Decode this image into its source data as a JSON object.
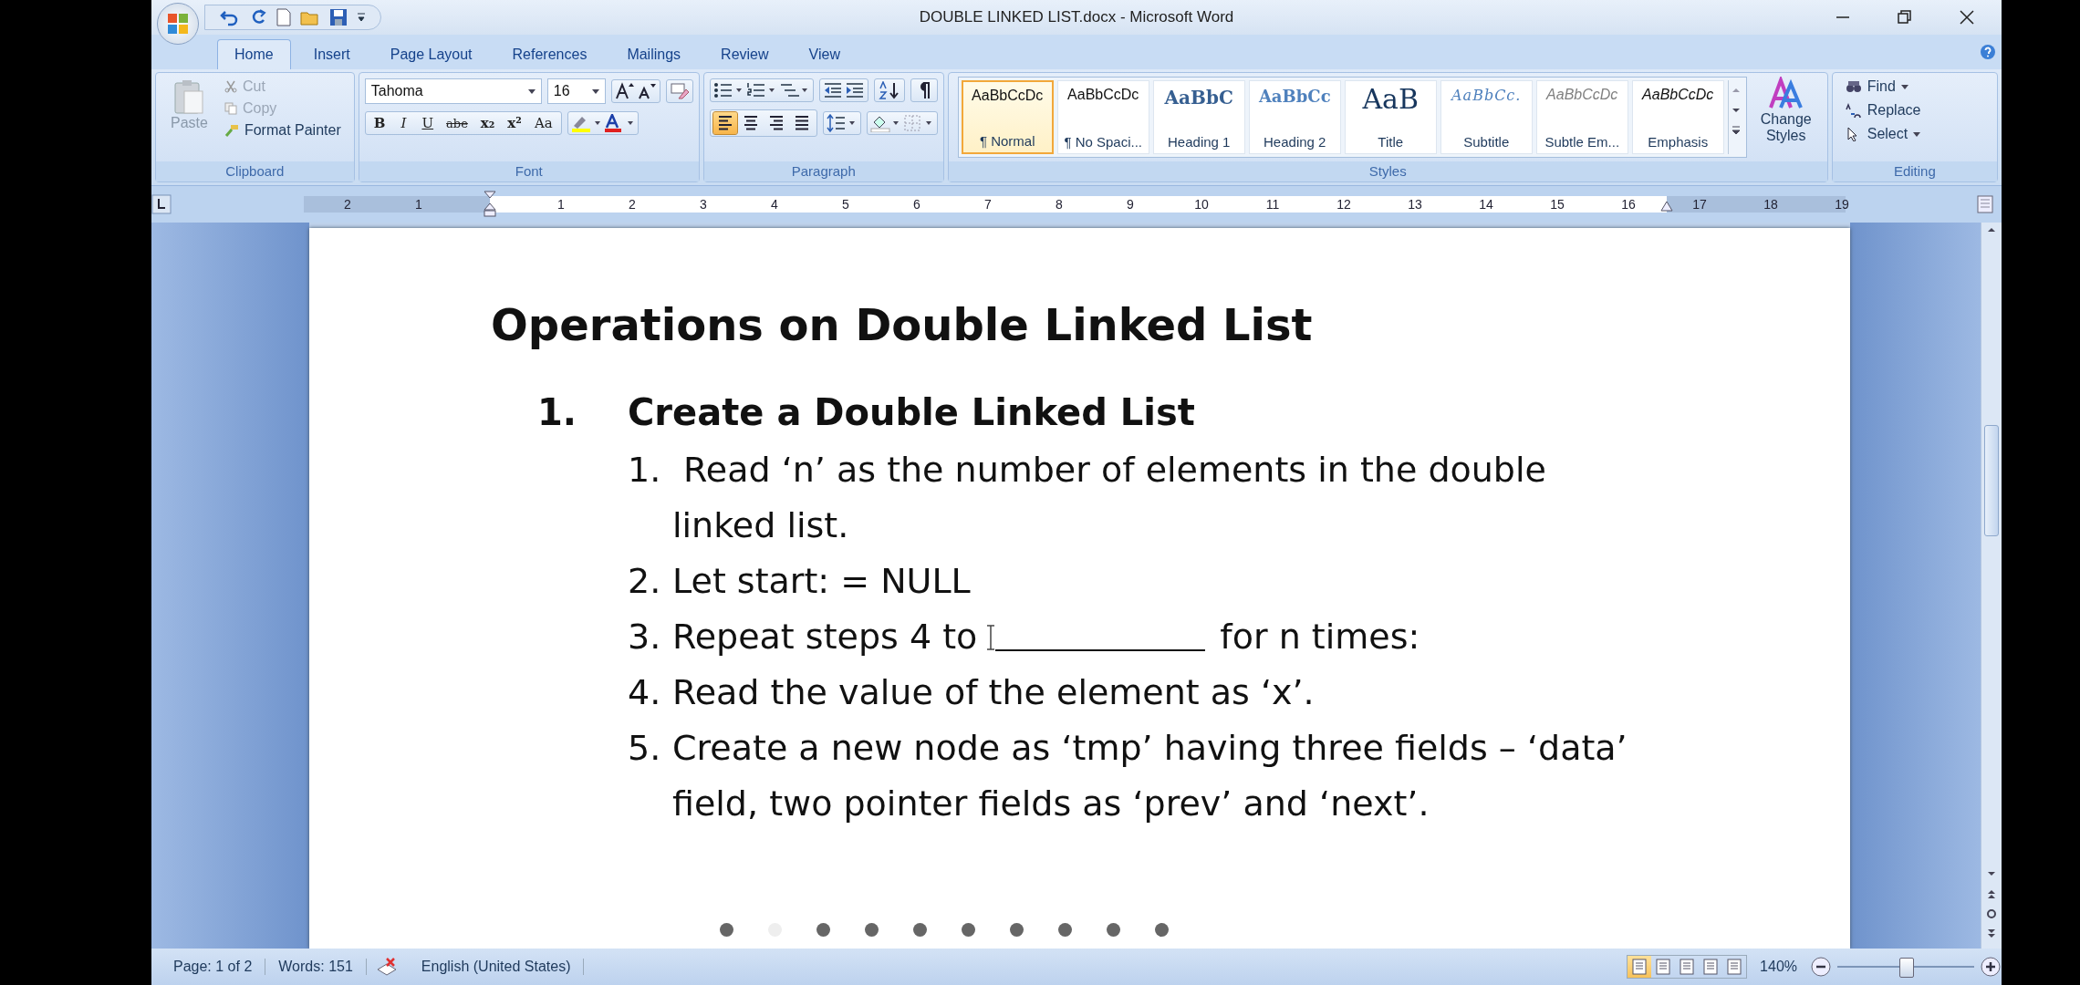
{
  "window": {
    "title": "DOUBLE LINKED LIST.docx - Microsoft Word"
  },
  "tabs": [
    {
      "label": "Home",
      "selected": true
    },
    {
      "label": "Insert",
      "selected": false
    },
    {
      "label": "Page Layout",
      "selected": false
    },
    {
      "label": "References",
      "selected": false
    },
    {
      "label": "Mailings",
      "selected": false
    },
    {
      "label": "Review",
      "selected": false
    },
    {
      "label": "View",
      "selected": false
    }
  ],
  "clipboard": {
    "label": "Clipboard",
    "paste": "Paste",
    "items": [
      {
        "label": "Cut",
        "disabled": true
      },
      {
        "label": "Copy",
        "disabled": true
      },
      {
        "label": "Format Painter",
        "disabled": false
      }
    ]
  },
  "font": {
    "label": "Font",
    "name": "Tahoma",
    "size": "16",
    "format_buttons": [
      "B",
      "I",
      "U",
      "abe",
      "x₂",
      "x²",
      "Aa"
    ]
  },
  "paragraph": {
    "label": "Paragraph",
    "alignments": [
      {
        "kind": "left",
        "selected": true
      },
      {
        "kind": "center",
        "selected": false
      },
      {
        "kind": "right",
        "selected": false
      },
      {
        "kind": "justify",
        "selected": false
      }
    ]
  },
  "styles": {
    "label": "Styles",
    "change_styles": "Change Styles",
    "gallery": [
      {
        "sample": "AaBbCcDc",
        "name": "¶ Normal",
        "kind": "normal",
        "selected": true
      },
      {
        "sample": "AaBbCcDc",
        "name": "¶ No Spaci...",
        "kind": "nospacing",
        "selected": false
      },
      {
        "sample": "AaBbC",
        "name": "Heading 1",
        "kind": "heading1",
        "selected": false
      },
      {
        "sample": "AaBbCc",
        "name": "Heading 2",
        "kind": "heading2",
        "selected": false
      },
      {
        "sample": "AaB",
        "name": "Title",
        "kind": "title",
        "selected": false
      },
      {
        "sample": "AaBbCc.",
        "name": "Subtitle",
        "kind": "subtitle",
        "selected": false
      },
      {
        "sample": "AaBbCcDc",
        "name": "Subtle Em...",
        "kind": "subtle",
        "selected": false
      },
      {
        "sample": "AaBbCcDc",
        "name": "Emphasis",
        "kind": "emphasis",
        "selected": false
      }
    ]
  },
  "editing": {
    "label": "Editing",
    "items": [
      "Find",
      "Replace",
      "Select"
    ]
  },
  "ruler": {
    "labels": [
      "2",
      "1",
      "1",
      "2",
      "3",
      "4",
      "5",
      "6",
      "7",
      "8",
      "9",
      "10",
      "11",
      "12",
      "13",
      "14",
      "15",
      "16",
      "17",
      "18",
      "19"
    ]
  },
  "document": {
    "title": "Operations on Double Linked List",
    "section": {
      "number": "1.",
      "heading": "Create a Double Linked List",
      "steps": [
        {
          "number": "1.",
          "lines": [
            " Read ‘n’ as the number of elements in the double",
            "linked list."
          ]
        },
        {
          "number": "2.",
          "lines": [
            "Let start: = NULL"
          ]
        },
        {
          "number": "3.",
          "lines": [
            "Repeat steps 4 to"
          ],
          "blank": true,
          "after": "for n times:"
        },
        {
          "number": "4.",
          "lines": [
            "Read the value of the element as ‘x’."
          ]
        },
        {
          "number": "5.",
          "lines": [
            "Create a new node as ‘tmp’ having three fields – ‘data’",
            "field, two pointer fields as ‘prev’ and ‘next’."
          ]
        }
      ]
    }
  },
  "pager": [
    {
      "selected": false
    },
    {
      "selected": true
    },
    {
      "selected": false
    },
    {
      "selected": false
    },
    {
      "selected": false
    },
    {
      "selected": false
    },
    {
      "selected": false
    },
    {
      "selected": false
    },
    {
      "selected": false
    },
    {
      "selected": false
    }
  ],
  "status_bar": {
    "page": "Page: 1 of 2",
    "words": "Words: 151",
    "language": "English (United States)",
    "views": [
      {
        "selected": true
      },
      {
        "selected": false
      },
      {
        "selected": false
      },
      {
        "selected": false
      },
      {
        "selected": false
      }
    ],
    "zoom": {
      "label": "140%",
      "level": 0.5
    }
  }
}
